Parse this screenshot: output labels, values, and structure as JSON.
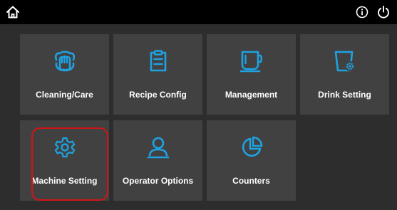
{
  "topbar": {
    "home_icon": "home-icon",
    "info_icon": "info-icon",
    "power_icon": "power-icon"
  },
  "colors": {
    "accent": "#1ea2e2",
    "tile_bg": "#414141",
    "background": "#2d2d2d",
    "topbar": "#000000",
    "highlight": "#d21416"
  },
  "tiles": [
    {
      "label": "Cleaning/Care",
      "icon": "hand-wash-icon"
    },
    {
      "label": "Recipe Config",
      "icon": "clipboard-icon"
    },
    {
      "label": "Management",
      "icon": "cup-icon"
    },
    {
      "label": "Drink Setting",
      "icon": "cup-gear-icon"
    },
    {
      "label": "Machine Setting",
      "icon": "gear-icon",
      "highlighted": true
    },
    {
      "label": "Operator Options",
      "icon": "user-icon"
    },
    {
      "label": "Counters",
      "icon": "pie-chart-icon"
    }
  ]
}
